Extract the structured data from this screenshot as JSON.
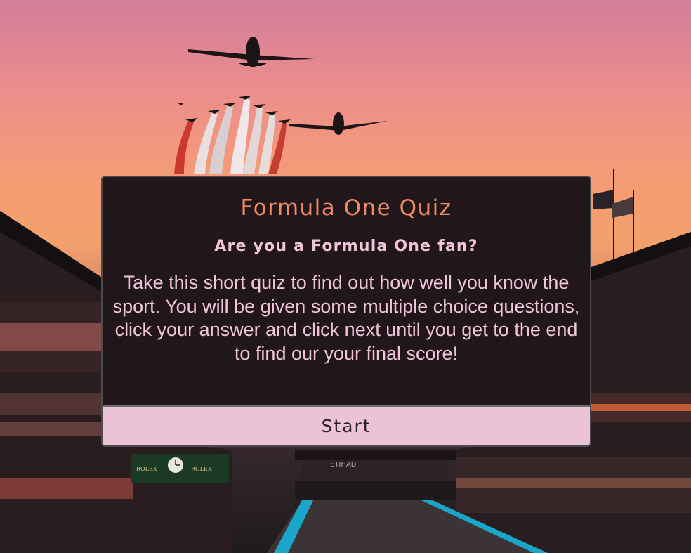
{
  "quiz": {
    "title": "Formula One Quiz",
    "subtitle": "Are you a Formula One fan?",
    "description": "Take this short quiz to find out how well you know the sport. You will be given some multiple choice questions, click your answer and click next until you get to the end to find our your final score!",
    "start_label": "Start"
  },
  "background": {
    "signage_left": "ROLEX",
    "signage_right": "ROLEX",
    "banner": "ETIHAD"
  },
  "colors": {
    "card_bg": "#21161a",
    "title": "#ef8a64",
    "text": "#f0c5da",
    "button_bg": "#ecc3d6"
  }
}
